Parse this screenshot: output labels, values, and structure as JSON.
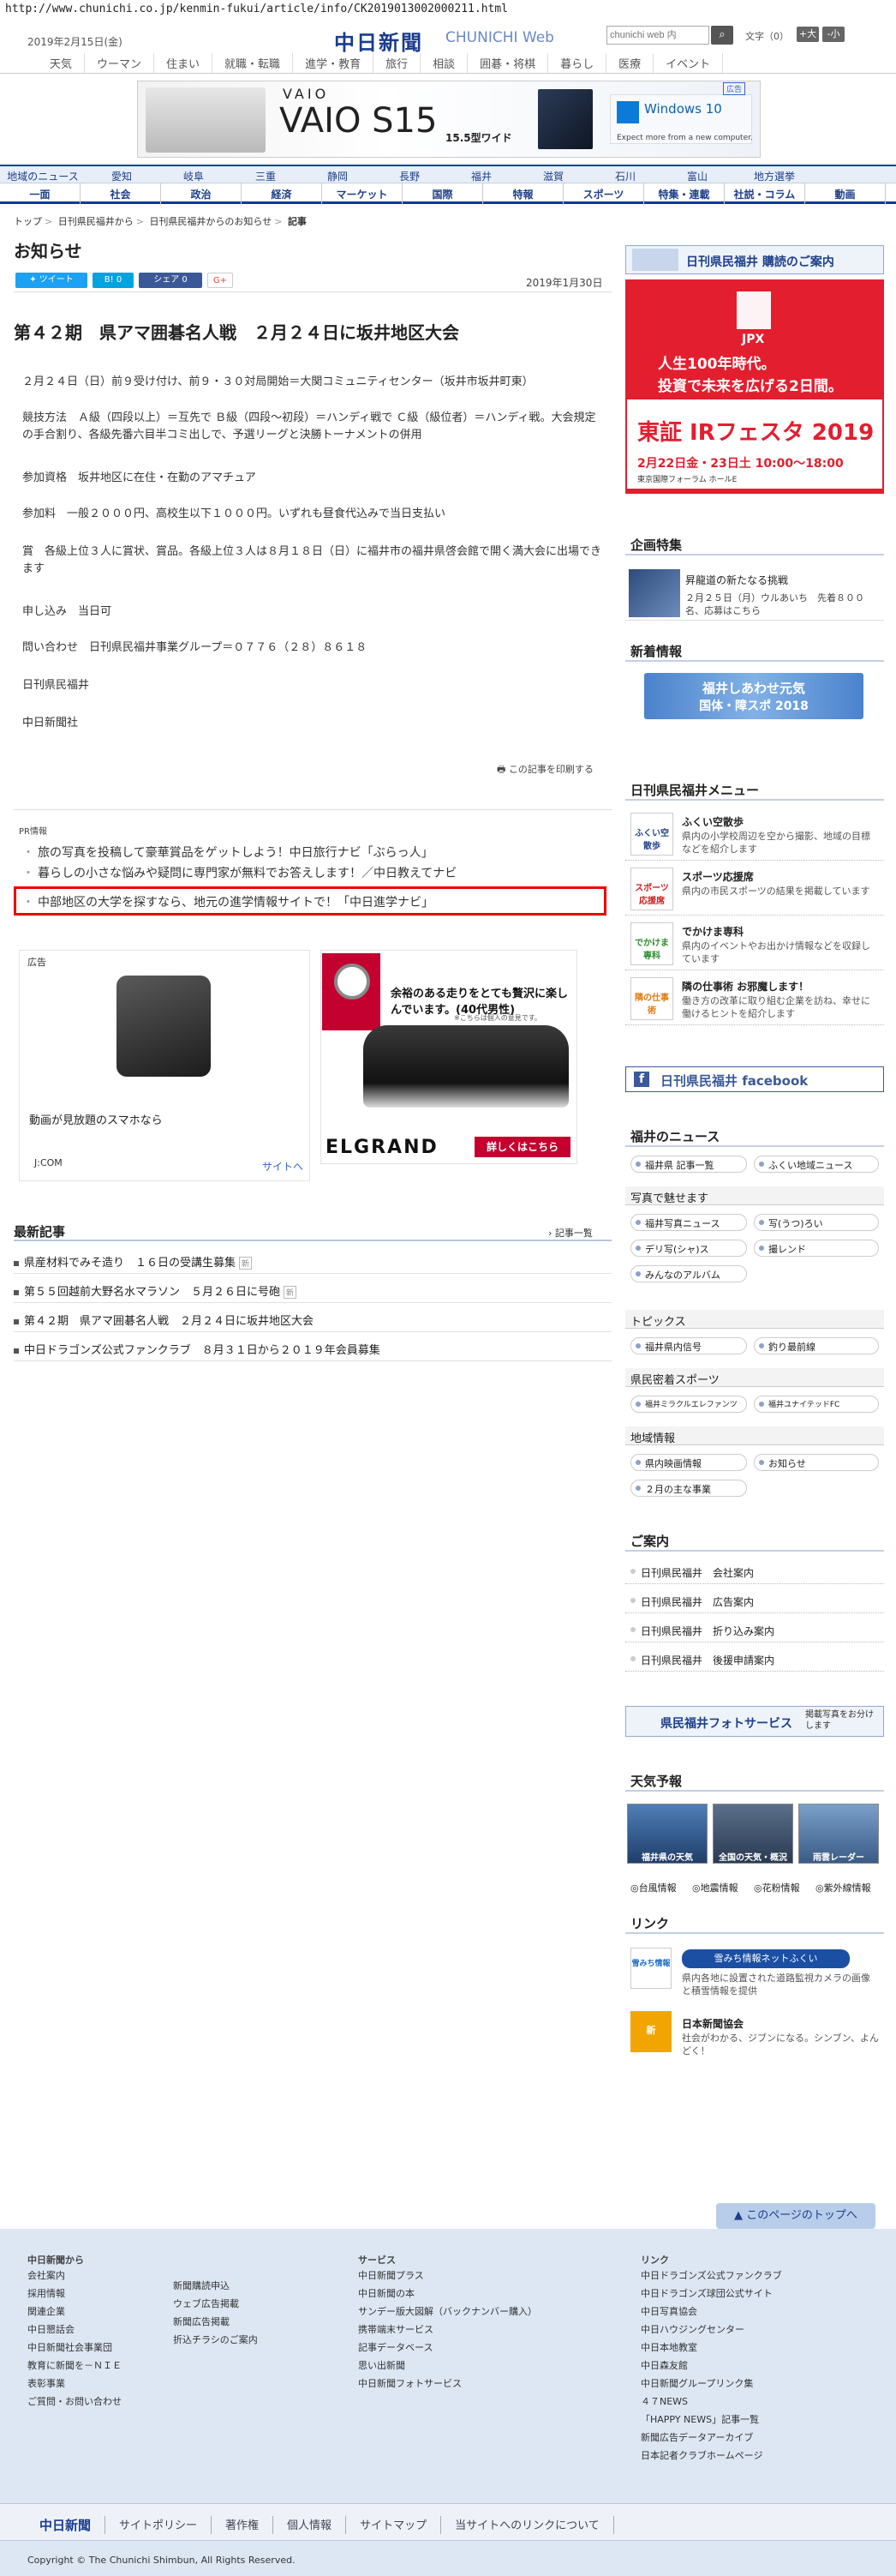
{
  "url": "http://www.chunichi.co.jp/kenmin-fukui/article/info/CK2019013002000211.html",
  "header": {
    "date": "2019年2月15日(金)",
    "logo": "中日新聞",
    "logo_en": "CHUNICHI Web",
    "search_placeholder": "chunichi web 内",
    "font_size_label": "文字（0）",
    "font_plus": "+大",
    "font_minus": "-小"
  },
  "top_nav": [
    "天気",
    "ウーマン",
    "住まい",
    "就職・転職",
    "進学・教育",
    "旅行",
    "相談",
    "囲碁・将棋",
    "暮らし",
    "医療",
    "イベント"
  ],
  "ad_banner": {
    "brand": "VAIO",
    "model": "VAIO S15",
    "sub": "15.5型ワイド",
    "win_text": "Windows 10",
    "win_sub": "Expect more from a new computer.",
    "ad_label": "広告"
  },
  "region_nav": [
    "地域のニュース",
    "愛知",
    "岐阜",
    "三重",
    "静岡",
    "長野",
    "福井",
    "滋賀",
    "石川",
    "富山",
    "地方選挙"
  ],
  "cat_nav": [
    "一面",
    "社会",
    "政治",
    "経済",
    "マーケット",
    "国際",
    "特報",
    "スポーツ",
    "特集・連載",
    "社説・コラム",
    "動画"
  ],
  "breadcrumb": [
    "トップ",
    "日刊県民福井から",
    "日刊県民福井からのお知らせ",
    "記事"
  ],
  "section_title": "お知らせ",
  "share": {
    "tweet": "ツイート",
    "hatena": "B! 0",
    "fb": "シェア 0",
    "gplus": "G+"
  },
  "article": {
    "date": "2019年1月30日",
    "headline": "第４２期　県アマ囲碁名人戦　２月２４日に坂井地区大会",
    "paragraphs": [
      "２月２４日（日）前９受け付け、前９・３０対局開始＝大関コミュニティセンター（坂井市坂井町東）",
      "競技方法　Ａ級（四段以上）＝互先で Ｂ級（四段～初段）＝ハンディ戦で Ｃ級（級位者）＝ハンディ戦。大会規定の手合割り、各級先番六目半コミ出しで、予選リーグと決勝トーナメントの併用",
      "参加資格　坂井地区に在住・在勤のアマチュア",
      "参加料　一般２０００円、高校生以下１０００円。いずれも昼食代込みで当日支払い",
      "賞　各級上位３人に賞状、賞品。各級上位３人は８月１８日（日）に福井市の福井県啓会館で開く満大会に出場できます",
      "申し込み　当日可",
      "問い合わせ　日刊県民福井事業グループ＝０７７６（２８）８６１８",
      "日刊県民福井",
      "中日新聞社"
    ],
    "print_link": "この記事を印刷する"
  },
  "pr": {
    "tag": "PR情報",
    "items": [
      "旅の写真を投稿して豪華賞品をゲットしよう！中日旅行ナビ「ぶらっ人」",
      "暮らしの小さな悩みや疑問に専門家が無料でお答えします！／中日教えてナビ",
      "中部地区の大学を探すなら、地元の進学情報サイトで！「中日進学ナビ」"
    ]
  },
  "ads": {
    "ad_label": "広告",
    "ad1_caption": "動画が見放題のスマホなら",
    "ad1_brand": "J:COM",
    "ad1_link": "サイトへ",
    "ad2_copy": "余裕のある走りをとても贅沢に楽しんでいます。(40代男性)",
    "ad2_note": "※こちらは個人の意見です。",
    "ad2_brand": "ELGRAND",
    "ad2_btn": "詳しくはこちら"
  },
  "latest": {
    "title": "最新記事",
    "more": "記事一覧",
    "items": [
      "県産材料でみそ造り　１６日の受講生募集",
      "第５５回越前大野名水マラソン　５月２６日に号砲",
      "第４２期　県アマ囲碁名人戦　２月２４日に坂井地区大会",
      "中日ドラゴンズ公式ファンクラブ　８月３１日から２０１９年会員募集"
    ],
    "new_label": "新"
  },
  "right": {
    "subscribe": "日刊県民福井 購読のご案内",
    "jpx": {
      "logo": "JPX",
      "l1": "人生100年時代。",
      "l2": "投資で未来を広げる2日間。",
      "title": "東証 IRフェスタ 2019",
      "date": "2月22日金・23日土 10:00～18:00",
      "venue": "東京国際フォーラム ホールE"
    },
    "kikaku_head": "企画特集",
    "kikaku_title": "昇龍道の新たなる挑戦",
    "kikaku_desc": "２月２５日（月）ウルあいち　先着８００名、応募はこちら",
    "new_info_head": "新着情報",
    "fukui_banner_l1": "福井しあわせ元気",
    "fukui_banner_l2": "国体・障スポ 2018",
    "menu_head": "日刊県民福井メニュー",
    "menu": [
      {
        "icon": "ふくい空散歩",
        "title": "ふくい空散歩",
        "desc": "県内の小学校周辺を空から撮影、地域の目標などを紹介します"
      },
      {
        "icon": "スポーツ応援席",
        "title": "スポーツ応援席",
        "desc": "県内の市民スポーツの結果を掲載しています"
      },
      {
        "icon": "でかけま専科",
        "title": "でかけま専科",
        "desc": "県内のイベントやお出かけ情報などを収録しています"
      },
      {
        "icon": "隣の仕事術",
        "title": "隣の仕事術 お邪魔します！",
        "desc": "働き方の改革に取り組む企業を訪ね、幸せに働けるヒントを紹介します"
      }
    ],
    "facebook": "日刊県民福井 facebook",
    "fukui_news_head": "福井のニュース",
    "fukui_news": [
      "福井県 記事一覧",
      "ふくい地域ニュース"
    ],
    "photo_head": "写真で魅せます",
    "photos": [
      "福井写真ニュース",
      "写(うつ)ろい",
      "デリ写(シャ)ス",
      "撮レンド",
      "みんなのアルバム"
    ],
    "topics_head": "トピックス",
    "topics": [
      "福井県内信号",
      "釣り最前線"
    ],
    "sports_head": "県民密着スポーツ",
    "sports": [
      "福井ミラクルエレファンツ",
      "福井ユナイテッドFC"
    ],
    "region_head": "地域情報",
    "region": [
      "県内映画情報",
      "お知らせ",
      "２月の主な事業"
    ],
    "annai_head": "ご案内",
    "annai": [
      "日刊県民福井　会社案内",
      "日刊県民福井　広告案内",
      "日刊県民福井　折り込み案内",
      "日刊県民福井　後援申請案内"
    ],
    "photo_service": "県民福井フォトサービス",
    "photo_service_sub": "掲載写真をお分けします",
    "weather_head": "天気予報",
    "weather": [
      "福井県の天気",
      "全国の天気・概況",
      "雨雲レーダー"
    ],
    "weather_links": [
      "台風情報",
      "地震情報",
      "花粉情報",
      "紫外線情報"
    ],
    "link_head": "リンク",
    "links": [
      {
        "title": "雪みち情報ネットふくい",
        "desc": "県内各地に設置された道路監視カメラの画像と積雪情報を提供"
      },
      {
        "title": "日本新聞協会",
        "desc": "社会がわかる、ジブンになる。シンブン、よんどく！"
      }
    ]
  },
  "footer": {
    "to_top": "このページのトップへ",
    "col1_head": "中日新聞から",
    "col1": [
      "会社案内",
      "採用情報",
      "関連企業",
      "中日懇話会",
      "中日新聞社会事業団",
      "教育に新聞を－ＮＩＥ",
      "表彰事業",
      "ご質問・お問い合わせ"
    ],
    "col2": [
      "新聞購読申込",
      "ウェブ広告掲載",
      "新聞広告掲載",
      "折込チラシのご案内"
    ],
    "col3_head": "サービス",
    "col3": [
      "中日新聞プラス",
      "中日新聞の本",
      "サンデー版大図解（バックナンバー購入）",
      "携帯端末サービス",
      "記事データベース",
      "思い出新聞",
      "中日新聞フォトサービス"
    ],
    "col4_head": "リンク",
    "col4": [
      "中日ドラゴンズ公式ファンクラブ",
      "中日ドラゴンズ球団公式サイト",
      "中日写真協会",
      "中日ハウジングセンター",
      "中日本地教室",
      "中日森友館",
      "中日新聞グループリンク集",
      "４７NEWS",
      "「HAPPY NEWS」記事一覧",
      "新聞広告データアーカイブ",
      "日本記者クラブホームページ"
    ],
    "bar_logo": "中日新聞",
    "bar": [
      "サイトポリシー",
      "著作権",
      "個人情報",
      "サイトマップ",
      "当サイトへのリンクについて"
    ],
    "copyright": "Copyright © The Chunichi Shimbun, All Rights Reserved."
  },
  "colors": {
    "brand": "#003e9f",
    "highlight": "#e00000",
    "jpx": "#e31e2e",
    "nissan": "#c3002f",
    "facebook": "#3b5998"
  }
}
